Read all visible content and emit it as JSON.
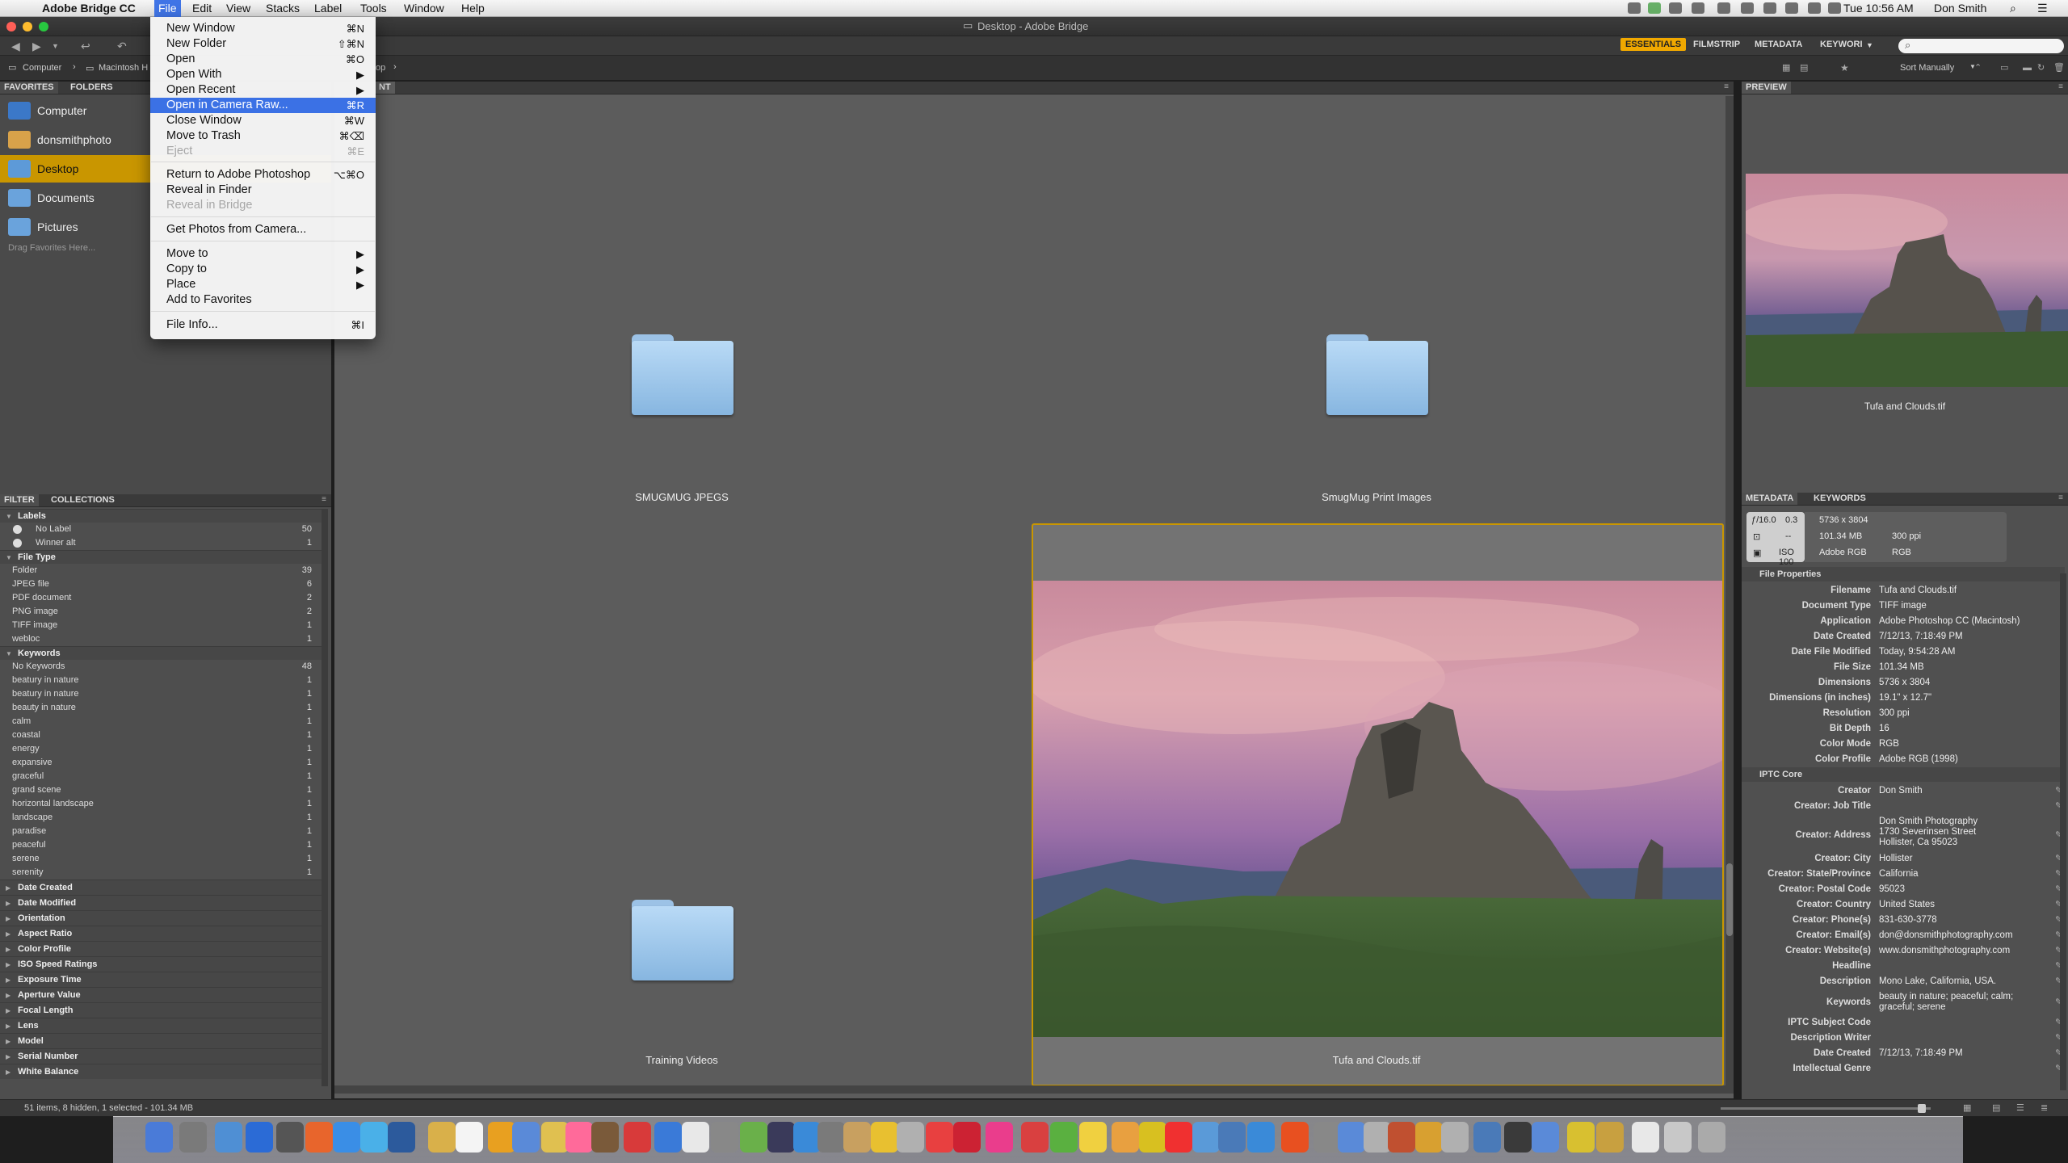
{
  "menubar": {
    "app_name": "Adobe Bridge CC",
    "menus": [
      "File",
      "Edit",
      "View",
      "Stacks",
      "Label",
      "Tools",
      "Window",
      "Help"
    ],
    "clock": "Tue 10:56 AM",
    "user": "Don Smith"
  },
  "window": {
    "title": "Desktop - Adobe Bridge"
  },
  "workspaces": [
    "ESSENTIALS",
    "FILMSTRIP",
    "METADATA",
    "KEYWORI"
  ],
  "search": {
    "placeholder": ""
  },
  "path": {
    "items": [
      "Computer",
      "Macintosh H",
      "op"
    ]
  },
  "sort": {
    "label": "Sort Manually"
  },
  "favorites_panel": {
    "tabs": [
      "FAVORITES",
      "FOLDERS"
    ],
    "items": [
      {
        "label": "Computer",
        "color": "#3b78c8"
      },
      {
        "label": "donsmithphoto",
        "color": "#d8a24a"
      },
      {
        "label": "Desktop",
        "color": "#5d9ad8"
      },
      {
        "label": "Documents",
        "color": "#6aa3dc"
      },
      {
        "label": "Pictures",
        "color": "#6aa3dc"
      }
    ],
    "hint": "Drag Favorites Here..."
  },
  "content_tab": {
    "label": "NT"
  },
  "file_menu": {
    "items": [
      {
        "label": "New Window",
        "shortcut": "⌘N"
      },
      {
        "label": "New Folder",
        "shortcut": "⇧⌘N"
      },
      {
        "label": "Open",
        "shortcut": "⌘O"
      },
      {
        "label": "Open With",
        "shortcut": "▶"
      },
      {
        "label": "Open Recent",
        "shortcut": "▶"
      },
      {
        "label": "Open in Camera Raw...",
        "shortcut": "⌘R"
      },
      {
        "label": "Close Window",
        "shortcut": "⌘W"
      },
      {
        "label": "Move to Trash",
        "shortcut": "⌘⌫"
      },
      {
        "label": "Eject",
        "shortcut": "⌘E"
      },
      {
        "label": "Return to Adobe Photoshop",
        "shortcut": "⌥⌘O"
      },
      {
        "label": "Reveal in Finder",
        "shortcut": ""
      },
      {
        "label": "Reveal in Bridge",
        "shortcut": ""
      },
      {
        "label": "Get Photos from Camera...",
        "shortcut": ""
      },
      {
        "label": "Move to",
        "shortcut": "▶"
      },
      {
        "label": "Copy to",
        "shortcut": "▶"
      },
      {
        "label": "Place",
        "shortcut": "▶"
      },
      {
        "label": "Add to Favorites",
        "shortcut": ""
      },
      {
        "label": "File Info...",
        "shortcut": "⌘I"
      }
    ]
  },
  "filter_panel": {
    "tabs": [
      "FILTER",
      "COLLECTIONS"
    ],
    "groups": [
      {
        "title": "Labels",
        "rows": [
          {
            "label": "No Label",
            "count": "50"
          },
          {
            "label": "Winner alt",
            "count": "1"
          }
        ]
      },
      {
        "title": "File Type",
        "rows": [
          {
            "label": "Folder",
            "count": "39"
          },
          {
            "label": "JPEG file",
            "count": "6"
          },
          {
            "label": "PDF document",
            "count": "2"
          },
          {
            "label": "PNG image",
            "count": "2"
          },
          {
            "label": "TIFF image",
            "count": "1"
          },
          {
            "label": "webloc",
            "count": "1"
          }
        ]
      },
      {
        "title": "Keywords",
        "rows": [
          {
            "label": "No Keywords",
            "count": "48"
          },
          {
            "label": "beatury in nature",
            "count": "1"
          },
          {
            "label": "beatury in nature",
            "count": "1"
          },
          {
            "label": "beauty in nature",
            "count": "1"
          },
          {
            "label": "calm",
            "count": "1"
          },
          {
            "label": "coastal",
            "count": "1"
          },
          {
            "label": "energy",
            "count": "1"
          },
          {
            "label": "expansive",
            "count": "1"
          },
          {
            "label": "graceful",
            "count": "1"
          },
          {
            "label": "grand scene",
            "count": "1"
          },
          {
            "label": "horizontal landscape",
            "count": "1"
          },
          {
            "label": "landscape",
            "count": "1"
          },
          {
            "label": "paradise",
            "count": "1"
          },
          {
            "label": "peaceful",
            "count": "1"
          },
          {
            "label": "serene",
            "count": "1"
          },
          {
            "label": "serenity",
            "count": "1"
          }
        ]
      }
    ],
    "collapsed": [
      "Date Created",
      "Date Modified",
      "Orientation",
      "Aspect Ratio",
      "Color Profile",
      "ISO Speed Ratings",
      "Exposure Time",
      "Aperture Value",
      "Focal Length",
      "Lens",
      "Model",
      "Serial Number",
      "White Balance"
    ]
  },
  "content": {
    "items": [
      {
        "label": "SMUGMUG JPEGS",
        "type": "folder"
      },
      {
        "label": "SmugMug Print Images",
        "type": "folder"
      },
      {
        "label": "Training Videos",
        "type": "folder"
      },
      {
        "label": "Tufa and Clouds.tif",
        "type": "image"
      }
    ]
  },
  "preview": {
    "tab": "PREVIEW",
    "caption": "Tufa and Clouds.tif"
  },
  "metadata_panel": {
    "tabs": [
      "METADATA",
      "KEYWORDS"
    ],
    "placard": {
      "aperture": "ƒ/16.0",
      "shutter": "0.3",
      "focal": "--",
      "iso": "ISO 100",
      "dims": "5736 x 3804",
      "size": "101.34 MB",
      "ppi": "300 ppi",
      "profile": "Adobe RGB",
      "mode": "RGB"
    },
    "file_properties_title": "File Properties",
    "file_properties": [
      {
        "k": "Filename",
        "v": "Tufa and Clouds.tif"
      },
      {
        "k": "Document Type",
        "v": "TIFF image"
      },
      {
        "k": "Application",
        "v": "Adobe Photoshop CC (Macintosh)"
      },
      {
        "k": "Date Created",
        "v": "7/12/13, 7:18:49 PM"
      },
      {
        "k": "Date File Modified",
        "v": "Today, 9:54:28 AM"
      },
      {
        "k": "File Size",
        "v": "101.34 MB"
      },
      {
        "k": "Dimensions",
        "v": "5736 x 3804"
      },
      {
        "k": "Dimensions (in inches)",
        "v": "19.1\" x 12.7\""
      },
      {
        "k": "Resolution",
        "v": "300 ppi"
      },
      {
        "k": "Bit Depth",
        "v": "16"
      },
      {
        "k": "Color Mode",
        "v": "RGB"
      },
      {
        "k": "Color Profile",
        "v": "Adobe RGB (1998)"
      }
    ],
    "iptc_title": "IPTC Core",
    "iptc": [
      {
        "k": "Creator",
        "v": "Don Smith"
      },
      {
        "k": "Creator: Job Title",
        "v": ""
      },
      {
        "k": "Creator: Address",
        "v": "Don Smith Photography\n1730 Severinsen Street\nHollister, Ca 95023"
      },
      {
        "k": "Creator: City",
        "v": "Hollister"
      },
      {
        "k": "Creator: State/Province",
        "v": "California"
      },
      {
        "k": "Creator: Postal Code",
        "v": "95023"
      },
      {
        "k": "Creator: Country",
        "v": "United States"
      },
      {
        "k": "Creator: Phone(s)",
        "v": "831-630-3778"
      },
      {
        "k": "Creator: Email(s)",
        "v": "don@donsmithphotography.com"
      },
      {
        "k": "Creator: Website(s)",
        "v": "www.donsmithphotography.com"
      },
      {
        "k": "Headline",
        "v": ""
      },
      {
        "k": "Description",
        "v": "Mono Lake, California, USA."
      },
      {
        "k": "Keywords",
        "v": "beauty in nature; peaceful; calm;\ngraceful; serene"
      },
      {
        "k": "IPTC Subject Code",
        "v": ""
      },
      {
        "k": "Description Writer",
        "v": ""
      },
      {
        "k": "Date Created",
        "v": "7/12/13, 7:18:49 PM"
      },
      {
        "k": "Intellectual Genre",
        "v": ""
      }
    ]
  },
  "status": {
    "text": "51 items, 8 hidden, 1 selected - 101.34 MB"
  },
  "colors": {
    "accent": "#f0a800",
    "selection": "#c99600",
    "menu_highlight": "#3b71e5"
  }
}
